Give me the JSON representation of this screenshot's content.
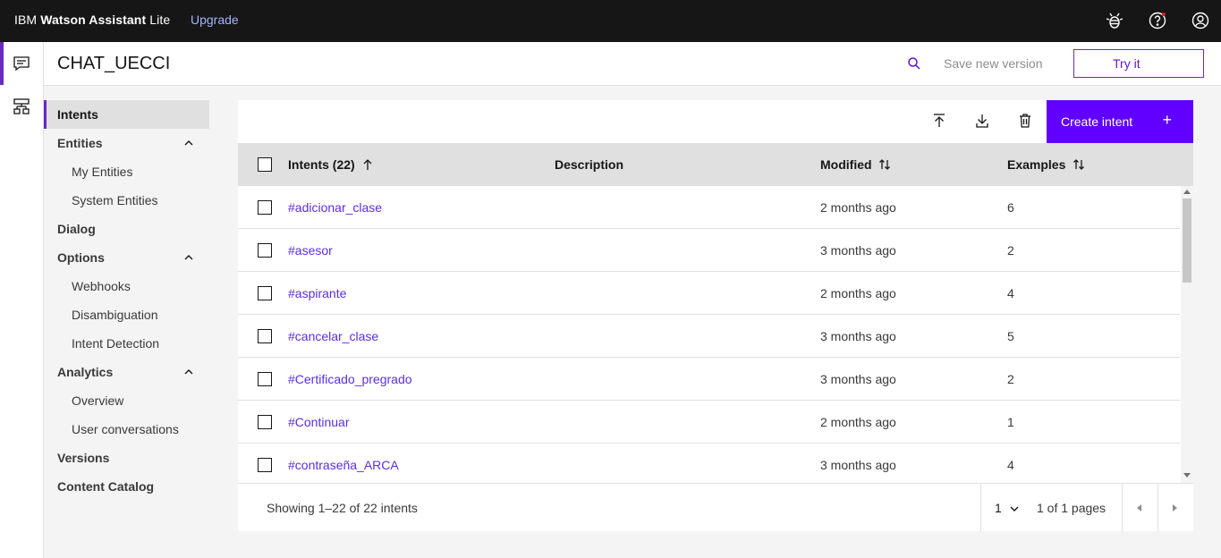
{
  "topbar": {
    "brand_ibm": "IBM",
    "brand_product": "Watson Assistant",
    "brand_plan": "Lite",
    "upgrade_label": "Upgrade",
    "icons": [
      "ibm-bee-icon",
      "help-icon",
      "user-avatar-icon"
    ],
    "notification_dot_color": "#da1e28"
  },
  "rail": {
    "items": [
      {
        "icon": "chat-icon",
        "active": true
      },
      {
        "icon": "skills-tree-icon",
        "active": false
      }
    ]
  },
  "header": {
    "skill_name": "CHAT_UECCI",
    "save_version_label": "Save new version",
    "try_it_label": "Try it"
  },
  "sidenav": {
    "items": [
      {
        "label": "Intents",
        "level": "top",
        "active": true
      },
      {
        "label": "Entities",
        "level": "top",
        "expanded": true
      },
      {
        "label": "My Entities",
        "level": "sub"
      },
      {
        "label": "System Entities",
        "level": "sub"
      },
      {
        "label": "Dialog",
        "level": "top"
      },
      {
        "label": "Options",
        "level": "top",
        "expanded": true
      },
      {
        "label": "Webhooks",
        "level": "sub"
      },
      {
        "label": "Disambiguation",
        "level": "sub"
      },
      {
        "label": "Intent Detection",
        "level": "sub"
      },
      {
        "label": "Analytics",
        "level": "top",
        "expanded": true
      },
      {
        "label": "Overview",
        "level": "sub"
      },
      {
        "label": "User conversations",
        "level": "sub"
      },
      {
        "label": "Versions",
        "level": "top"
      },
      {
        "label": "Content Catalog",
        "level": "top"
      }
    ]
  },
  "toolbar": {
    "icons": [
      "upload-icon",
      "download-icon",
      "trash-icon"
    ],
    "create_label": "Create intent",
    "create_icon": "+"
  },
  "table": {
    "columns": {
      "intents": "Intents (22)",
      "description": "Description",
      "modified": "Modified",
      "examples": "Examples"
    },
    "rows": [
      {
        "name": "#adicionar_clase",
        "description": "",
        "modified": "2 months ago",
        "examples": "6"
      },
      {
        "name": "#asesor",
        "description": "",
        "modified": "3 months ago",
        "examples": "2"
      },
      {
        "name": "#aspirante",
        "description": "",
        "modified": "2 months ago",
        "examples": "4"
      },
      {
        "name": "#cancelar_clase",
        "description": "",
        "modified": "3 months ago",
        "examples": "5"
      },
      {
        "name": "#Certificado_pregrado",
        "description": "",
        "modified": "3 months ago",
        "examples": "2"
      },
      {
        "name": "#Continuar",
        "description": "",
        "modified": "2 months ago",
        "examples": "1"
      },
      {
        "name": "#contraseña_ARCA",
        "description": "",
        "modified": "3 months ago",
        "examples": "4"
      }
    ]
  },
  "pagination": {
    "showing": "Showing 1–22 of 22 intents",
    "current_page": "1",
    "of_pages": "1 of 1 pages"
  },
  "colors": {
    "accent": "#6929c4",
    "primary_button": "#6100ff",
    "link": "#5b2de0",
    "topbar": "#161616"
  }
}
